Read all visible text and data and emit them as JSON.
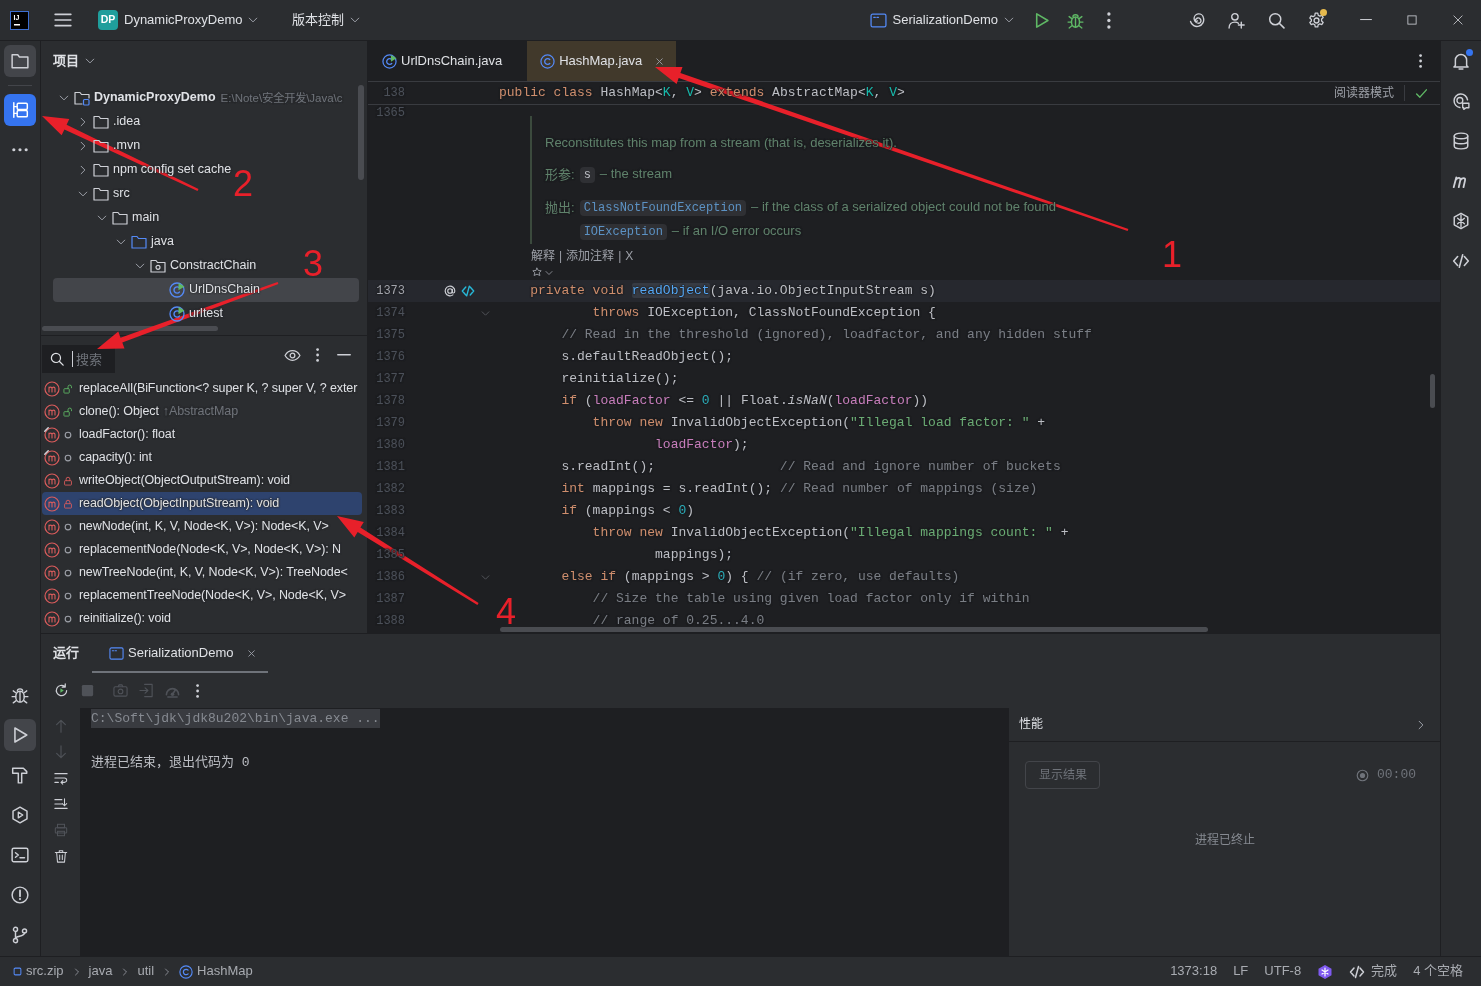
{
  "title_bar": {
    "logo": "IJ",
    "project": {
      "badge": "DP",
      "name": "DynamicProxyDemo"
    },
    "vcs_menu": "版本控制",
    "run_configuration": "SerializationDemo",
    "settings_badge": true
  },
  "left_toolbar": {
    "top": [
      {
        "kind": "project",
        "selected": true,
        "focused": false
      },
      {
        "kind": "structure",
        "selected": true,
        "focused": true
      },
      {
        "kind": "more",
        "selected": false,
        "focused": false
      }
    ],
    "bottom": [
      {
        "kind": "debug",
        "selected": false,
        "focused": false
      },
      {
        "kind": "run",
        "selected": true,
        "focused": false
      },
      {
        "kind": "build",
        "selected": false,
        "focused": false
      },
      {
        "kind": "services",
        "selected": false,
        "focused": false
      },
      {
        "kind": "terminal",
        "selected": false,
        "focused": false
      },
      {
        "kind": "problems",
        "selected": false,
        "focused": false
      },
      {
        "kind": "git",
        "selected": false,
        "focused": false
      }
    ]
  },
  "project_panel": {
    "title": "项目",
    "tree": [
      {
        "label": "DynamicProxyDemo",
        "kind": "module",
        "hint": "E:\\Note\\安全开发\\Java\\c",
        "expanded": true,
        "selected": false,
        "children": [
          {
            "label": ".idea",
            "kind": "folder",
            "expanded": false,
            "selected": false
          },
          {
            "label": ".mvn",
            "kind": "folder",
            "expanded": false,
            "selected": false
          },
          {
            "label": "npm config set cache",
            "kind": "folder",
            "expanded": false,
            "selected": false
          },
          {
            "label": "src",
            "kind": "folder",
            "expanded": true,
            "selected": false,
            "children": [
              {
                "label": "main",
                "kind": "folder",
                "expanded": true,
                "selected": false,
                "children": [
                  {
                    "label": "java",
                    "kind": "source_root",
                    "expanded": true,
                    "selected": false,
                    "children": [
                      {
                        "label": "ConstractChain",
                        "kind": "package",
                        "expanded": true,
                        "selected": false,
                        "children": [
                          {
                            "label": "UrlDnsChain",
                            "kind": "runnable_class",
                            "selected": true
                          },
                          {
                            "label": "urltest",
                            "kind": "runnable_class",
                            "selected": false
                          }
                        ]
                      }
                    ]
                  }
                ]
              }
            ]
          }
        ]
      }
    ]
  },
  "structure_panel": {
    "search": {
      "placeholder": "搜索"
    },
    "members": [
      {
        "label": "replaceAll(BiFunction<? super K, ? super V, ? exter",
        "kind": "public",
        "marked": false,
        "selected": false
      },
      {
        "label": "clone(): Object",
        "hint": "↑AbstractMap",
        "kind": "public",
        "marked": false,
        "selected": false
      },
      {
        "label": "loadFactor(): float",
        "kind": "package",
        "marked": true,
        "selected": false
      },
      {
        "label": "capacity(): int",
        "kind": "package",
        "marked": true,
        "selected": false
      },
      {
        "label": "writeObject(ObjectOutputStream): void",
        "kind": "private",
        "marked": false,
        "selected": false
      },
      {
        "label": "readObject(ObjectInputStream): void",
        "kind": "private",
        "marked": false,
        "selected": true
      },
      {
        "label": "newNode(int, K, V, Node<K, V>): Node<K, V>",
        "kind": "package",
        "marked": false,
        "selected": false
      },
      {
        "label": "replacementNode(Node<K, V>, Node<K, V>): N",
        "kind": "package",
        "marked": false,
        "selected": false
      },
      {
        "label": "newTreeNode(int, K, V, Node<K, V>): TreeNode<",
        "kind": "package",
        "marked": false,
        "selected": false
      },
      {
        "label": "replacementTreeNode(Node<K, V>, Node<K, V>",
        "kind": "package",
        "marked": false,
        "selected": false
      },
      {
        "label": "reinitialize(): void",
        "kind": "package",
        "marked": false,
        "selected": false
      }
    ]
  },
  "editor": {
    "tabs": [
      {
        "label": "UrlDnsChain.java",
        "kind": "runnable_class",
        "selected": false
      },
      {
        "label": "HashMap.java",
        "kind": "class",
        "selected": true
      }
    ],
    "sticky_line": {
      "number": "138",
      "tokens": [
        {
          "text": "public class",
          "kind": "keyword"
        },
        {
          "text": " HashMap<",
          "kind": "plain"
        },
        {
          "text": "K",
          "kind": "type_param"
        },
        {
          "text": ", ",
          "kind": "plain"
        },
        {
          "text": "V",
          "kind": "type_param"
        },
        {
          "text": "> ",
          "kind": "plain"
        },
        {
          "text": "extends",
          "kind": "keyword"
        },
        {
          "text": " AbstractMap<",
          "kind": "plain"
        },
        {
          "text": "K",
          "kind": "type_param"
        },
        {
          "text": ", ",
          "kind": "plain"
        },
        {
          "text": "V",
          "kind": "type_param"
        },
        {
          "text": ">",
          "kind": "plain"
        }
      ]
    },
    "reader_mode": "阅读器模式",
    "doc": {
      "line_number": "1365",
      "summary": "Reconstitutes this map from a stream (that is, deserializes it).",
      "params_label": "形参:",
      "params": [
        {
          "name": "s",
          "text": "– the stream"
        }
      ],
      "throws_label": "抛出:",
      "throws": [
        {
          "name": "ClassNotFoundException",
          "text": "– if the class of a serialized object could not be found"
        },
        {
          "name": "IOException",
          "text": "– if an I/O error occurs"
        }
      ]
    },
    "inlay_actions": [
      "解释",
      "添加注释",
      "X"
    ],
    "inlay_separator": "|",
    "lines": [
      {
        "number": "1373",
        "current": true,
        "markers": true,
        "foldable": false,
        "tokens": [
          {
            "text": "    private void ",
            "kind": "keyword"
          },
          {
            "text": "readObject",
            "kind": "declaration"
          },
          {
            "text": "(java.io.ObjectInputStream s)",
            "kind": "plain"
          }
        ]
      },
      {
        "number": "1374",
        "current": false,
        "markers": false,
        "foldable": true,
        "tokens": [
          {
            "text": "            throws",
            "kind": "keyword"
          },
          {
            "text": " IOException, ClassNotFoundException {",
            "kind": "plain"
          }
        ]
      },
      {
        "number": "1375",
        "current": false,
        "markers": false,
        "foldable": false,
        "tokens": [
          {
            "text": "        // Read in the threshold (ignored), loadfactor, and any hidden stuff",
            "kind": "comment"
          }
        ]
      },
      {
        "number": "1376",
        "current": false,
        "markers": false,
        "foldable": false,
        "tokens": [
          {
            "text": "        s.defaultReadObject();",
            "kind": "plain"
          }
        ]
      },
      {
        "number": "1377",
        "current": false,
        "markers": false,
        "foldable": false,
        "tokens": [
          {
            "text": "        reinitialize();",
            "kind": "plain"
          }
        ]
      },
      {
        "number": "1378",
        "current": false,
        "markers": false,
        "foldable": false,
        "tokens": [
          {
            "text": "        if",
            "kind": "keyword"
          },
          {
            "text": " (",
            "kind": "plain"
          },
          {
            "text": "loadFactor",
            "kind": "field"
          },
          {
            "text": " <= ",
            "kind": "plain"
          },
          {
            "text": "0",
            "kind": "number"
          },
          {
            "text": " || Float.",
            "kind": "plain"
          },
          {
            "text": "isNaN",
            "kind": "static_call"
          },
          {
            "text": "(",
            "kind": "plain"
          },
          {
            "text": "loadFactor",
            "kind": "field"
          },
          {
            "text": "))",
            "kind": "plain"
          }
        ]
      },
      {
        "number": "1379",
        "current": false,
        "markers": false,
        "foldable": false,
        "tokens": [
          {
            "text": "            throw new",
            "kind": "keyword"
          },
          {
            "text": " InvalidObjectException(",
            "kind": "plain"
          },
          {
            "text": "\"Illegal load factor: \"",
            "kind": "string"
          },
          {
            "text": " +",
            "kind": "plain"
          }
        ]
      },
      {
        "number": "1380",
        "current": false,
        "markers": false,
        "foldable": false,
        "tokens": [
          {
            "text": "                    loadFactor",
            "kind": "field"
          },
          {
            "text": ");",
            "kind": "plain"
          }
        ]
      },
      {
        "number": "1381",
        "current": false,
        "markers": false,
        "foldable": false,
        "tokens": [
          {
            "text": "        s.readInt();                ",
            "kind": "plain"
          },
          {
            "text": "// Read and ignore number of buckets",
            "kind": "comment"
          }
        ]
      },
      {
        "number": "1382",
        "current": false,
        "markers": false,
        "foldable": false,
        "tokens": [
          {
            "text": "        int",
            "kind": "keyword"
          },
          {
            "text": " mappings = s.readInt(); ",
            "kind": "plain"
          },
          {
            "text": "// Read number of mappings (size)",
            "kind": "comment"
          }
        ]
      },
      {
        "number": "1383",
        "current": false,
        "markers": false,
        "foldable": false,
        "tokens": [
          {
            "text": "        if",
            "kind": "keyword"
          },
          {
            "text": " (mappings < ",
            "kind": "plain"
          },
          {
            "text": "0",
            "kind": "number"
          },
          {
            "text": ")",
            "kind": "plain"
          }
        ]
      },
      {
        "number": "1384",
        "current": false,
        "markers": false,
        "foldable": false,
        "tokens": [
          {
            "text": "            throw new",
            "kind": "keyword"
          },
          {
            "text": " InvalidObjectException(",
            "kind": "plain"
          },
          {
            "text": "\"Illegal mappings count: \"",
            "kind": "string"
          },
          {
            "text": " +",
            "kind": "plain"
          }
        ]
      },
      {
        "number": "1385",
        "current": false,
        "markers": false,
        "foldable": false,
        "tokens": [
          {
            "text": "                    mappings);",
            "kind": "plain"
          }
        ]
      },
      {
        "number": "1386",
        "current": false,
        "markers": false,
        "foldable": true,
        "tokens": [
          {
            "text": "        else if",
            "kind": "keyword"
          },
          {
            "text": " (mappings > ",
            "kind": "plain"
          },
          {
            "text": "0",
            "kind": "number"
          },
          {
            "text": ") { ",
            "kind": "plain"
          },
          {
            "text": "// (if zero, use defaults)",
            "kind": "comment"
          }
        ]
      },
      {
        "number": "1387",
        "current": false,
        "markers": false,
        "foldable": false,
        "tokens": [
          {
            "text": "            // Size the table using given load factor only if within",
            "kind": "comment"
          }
        ]
      },
      {
        "number": "1388",
        "current": false,
        "markers": false,
        "foldable": false,
        "tokens": [
          {
            "text": "            // range of 0.25...4.0",
            "kind": "comment"
          }
        ]
      }
    ]
  },
  "right_toolbar": [
    {
      "kind": "notifications",
      "badge": true
    },
    {
      "kind": "ai_chat",
      "badge": false
    },
    {
      "kind": "database",
      "badge": false
    },
    {
      "kind": "maven",
      "badge": false
    },
    {
      "kind": "ai_assistant",
      "badge": false
    },
    {
      "kind": "code_with_me",
      "badge": false
    }
  ],
  "run_panel": {
    "title": "运行",
    "tabs": [
      {
        "label": "SerializationDemo",
        "selected": true
      }
    ],
    "toolbar": [
      {
        "kind": "rerun",
        "disabled": false
      },
      {
        "kind": "stop",
        "disabled": true
      },
      {
        "kind": "screenshot",
        "disabled": true
      },
      {
        "kind": "export",
        "disabled": true
      },
      {
        "kind": "profiler",
        "disabled": true
      },
      {
        "kind": "more",
        "disabled": false
      }
    ],
    "console_actions": [
      {
        "kind": "up",
        "disabled": true
      },
      {
        "kind": "down",
        "disabled": true
      },
      {
        "kind": "soft_wrap",
        "disabled": false
      },
      {
        "kind": "scroll_end",
        "disabled": false
      },
      {
        "kind": "print",
        "disabled": true
      },
      {
        "kind": "clear",
        "disabled": false
      }
    ],
    "console": [
      {
        "text": "C:\\Soft\\jdk\\jdk8u202\\bin\\java.exe ...",
        "kind": "command"
      },
      {
        "text": "进程已结束，退出代码为 0",
        "kind": "output"
      }
    ],
    "performance": {
      "title": "性能",
      "button": {
        "label": "显示结果",
        "disabled": true
      },
      "timer": "00:00",
      "message": "进程已终止"
    }
  },
  "status_bar": {
    "breadcrumbs": [
      {
        "label": "src.zip",
        "kind": "archive"
      },
      {
        "label": "java",
        "kind": "package"
      },
      {
        "label": "util",
        "kind": "package"
      },
      {
        "label": "HashMap",
        "kind": "class"
      }
    ],
    "position": "1373:18",
    "line_separator": "LF",
    "encoding": "UTF-8",
    "completion": "完成",
    "indent": "4 个空格"
  },
  "annotations": [
    {
      "label": "1"
    },
    {
      "label": "2"
    },
    {
      "label": "3"
    },
    {
      "label": "4"
    }
  ]
}
